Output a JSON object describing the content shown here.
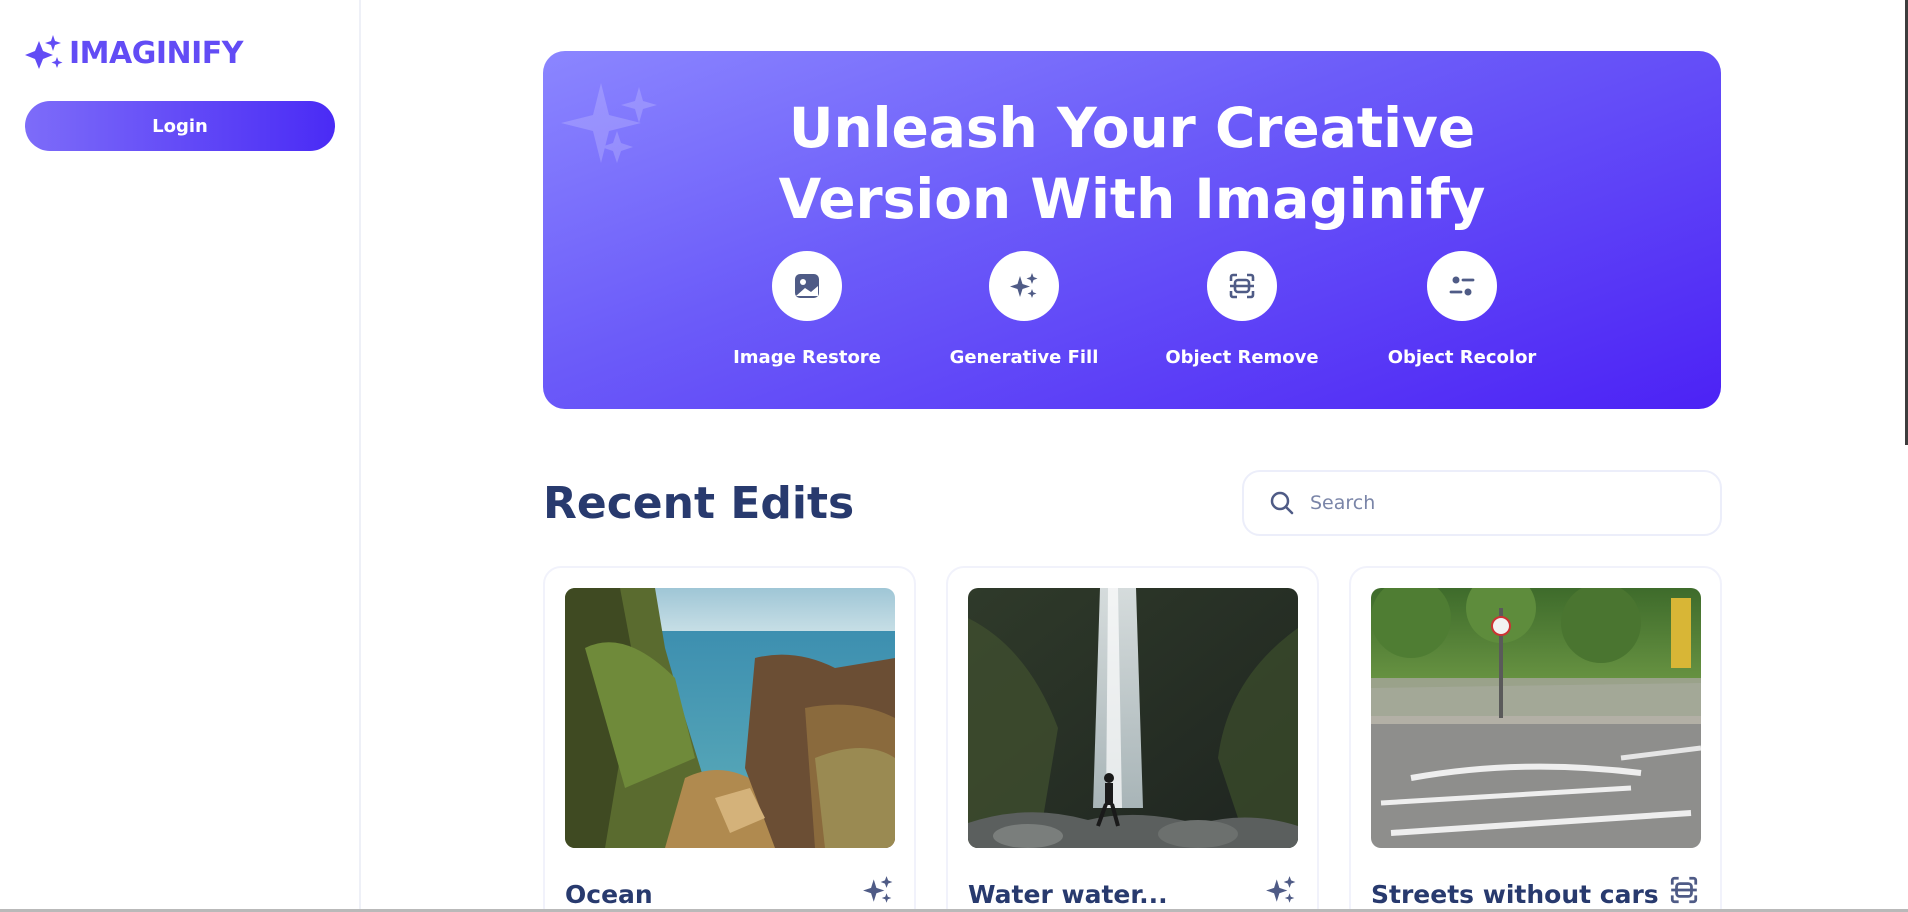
{
  "app": {
    "name": "IMAGINIFY",
    "brand_color": "#624cf5"
  },
  "sidebar": {
    "login_label": "Login"
  },
  "banner": {
    "title_line1": "Unleash Your Creative",
    "title_line2": "Version With Imaginify",
    "tools": [
      {
        "label": "Image Restore",
        "icon": "image-icon"
      },
      {
        "label": "Generative Fill",
        "icon": "sparkles-icon"
      },
      {
        "label": "Object Remove",
        "icon": "scan-icon"
      },
      {
        "label": "Object Recolor",
        "icon": "filter-icon"
      }
    ]
  },
  "recent": {
    "title": "Recent Edits",
    "search_placeholder": "Search",
    "cards": [
      {
        "title": "Ocean",
        "icon": "sparkles-icon"
      },
      {
        "title": "Water water...",
        "icon": "sparkles-icon"
      },
      {
        "title": "Streets without cars",
        "icon": "scan-icon"
      }
    ]
  }
}
